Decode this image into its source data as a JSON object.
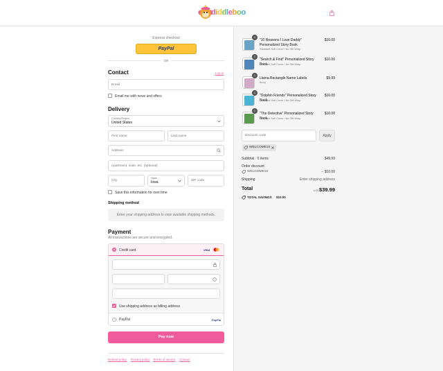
{
  "brand": {
    "name": "diddleboo"
  },
  "express": {
    "label": "Express checkout",
    "paypal": "PayPal",
    "or": "OR"
  },
  "contact": {
    "title": "Contact",
    "login": "Log in",
    "email_placeholder": "Email",
    "news_label": "Email me with news and offers"
  },
  "delivery": {
    "title": "Delivery",
    "country_label": "Country/Region",
    "country_value": "United States",
    "first_name": "First name",
    "last_name": "Last name",
    "address": "Address",
    "apartment": "Apartment, suite, etc. (optional)",
    "city": "City",
    "state_label": "State",
    "state_value": "Iowa",
    "zip": "ZIP code",
    "save_label": "Save this information for next time"
  },
  "shipping_method": {
    "title": "Shipping method",
    "message": "Enter your shipping address to view available shipping methods."
  },
  "payment": {
    "title": "Payment",
    "subtitle": "All transactions are secure and encrypted.",
    "credit_card": "Credit card",
    "visa": "VISA",
    "billing_label": "Use shipping address as billing address",
    "paypal": "PayPal",
    "paypal_logo": "PayPal",
    "pay_now": "Pay now"
  },
  "footer_links": [
    "Refund policy",
    "Privacy policy",
    "Terms of service",
    "Contact"
  ],
  "cart": {
    "items": [
      {
        "qty": "1",
        "name": "\"10 Reasons I Love Daddy\" Personalized Story Book",
        "variant": "Standard Soft Cover / No Gift Wrap",
        "price": "$10.00",
        "color": "#6aa3c8"
      },
      {
        "qty": "1",
        "name": "\"Search & Find\" Personalized Story Book",
        "variant": "Standard Soft Cover / No Gift Wrap",
        "price": "$10.00",
        "color": "#4f86b9"
      },
      {
        "qty": "1",
        "name": "Llama Rectangle Name Labels",
        "variant": "Berry",
        "price": "$9.99",
        "color": "#d3a9c8"
      },
      {
        "qty": "1",
        "name": "\"Dolphin Friends\" Personalized Story Book",
        "variant": "Standard Soft Cover / No Gift Wrap",
        "price": "$10.00",
        "color": "#4ab3d6"
      },
      {
        "qty": "1",
        "name": "\"The Detective\" Personalized Story Book",
        "variant": "Standard Soft Cover / No Gift Wrap",
        "price": "$10.00",
        "color": "#5a9a4e"
      }
    ],
    "discount_placeholder": "Discount code",
    "apply": "Apply",
    "code_tag": "WELCOME10",
    "subtotal_label": "Subtotal · 5 items",
    "subtotal_value": "$49.99",
    "order_discount_label": "Order discount",
    "discount_code": "WELCOME10",
    "discount_value": "− $10.00",
    "shipping_label": "Shipping",
    "shipping_value": "Enter shipping address",
    "total_label": "Total",
    "currency": "USD",
    "total_value": "$39.99",
    "savings_label": "TOTAL SAVINGS",
    "savings_value": "$10.00"
  },
  "colors": {
    "accent": "#ef5b9c",
    "paypal_yellow": "#ffc439",
    "panel": "#f5f5f5"
  }
}
